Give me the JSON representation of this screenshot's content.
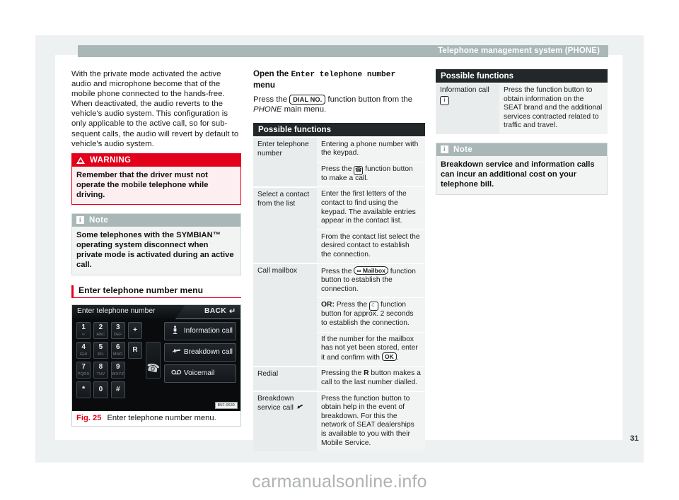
{
  "header": {
    "title": "Telephone management system (PHONE)"
  },
  "page_number": "31",
  "watermark": "carmanualsonline.info",
  "left_column": {
    "paragraph": "With the private mode activated the active audio and microphone become that of the mobile phone connected to the hands-free. When deactivated, the audio reverts to the vehicle's audio system. This configuration is only applicable to the active call, so for sub-sequent calls, the audio will revert by default to vehicle's audio system.",
    "warning": {
      "label": "WARNING",
      "icon": "warning-triangle-icon",
      "text": "Remember that the driver must not operate the mobile telephone while driving."
    },
    "note": {
      "label": "Note",
      "icon": "info-icon",
      "text": "Some telephones with the SYMBIAN™ operating system disconnect when private mode is activated during an active call."
    },
    "section_heading": "Enter telephone number menu",
    "figure": {
      "screen_title": "Enter telephone number",
      "back_label": "BACK",
      "keys": [
        {
          "num": "1",
          "letters": "∞"
        },
        {
          "num": "2",
          "letters": "ABC"
        },
        {
          "num": "3",
          "letters": "DEF"
        },
        {
          "num": "+",
          "letters": ""
        },
        {
          "num": "4",
          "letters": "GHI"
        },
        {
          "num": "5",
          "letters": "JKL"
        },
        {
          "num": "6",
          "letters": "MNO"
        },
        {
          "num": "R",
          "letters": ""
        },
        {
          "num": "7",
          "letters": "PQRS"
        },
        {
          "num": "8",
          "letters": "TUV"
        },
        {
          "num": "9",
          "letters": "WXYZ"
        },
        {
          "num": "*",
          "letters": ""
        },
        {
          "num": "0",
          "letters": ""
        },
        {
          "num": "#",
          "letters": ""
        }
      ],
      "call_button_icon": "phone-handset-icon",
      "side_buttons": [
        {
          "icon": "information-call-icon",
          "glyph": "ℹ",
          "label": "Information call"
        },
        {
          "icon": "breakdown-call-wrench-icon",
          "glyph": "—",
          "label": "Breakdown call"
        },
        {
          "icon": "voicemail-icon",
          "glyph": "∞",
          "label": "Voicemail"
        }
      ],
      "image_code": "B5F-0639",
      "caption_number": "Fig. 25",
      "caption_text": "Enter telephone number menu."
    }
  },
  "middle_column": {
    "heading_prefix": "Open the ",
    "heading_mono": "Enter telephone number",
    "heading_suffix": "menu",
    "instruction_pre": "Press the ",
    "instruction_button": "DIAL NO.",
    "instruction_post_1": " function button from the ",
    "instruction_italic": "PHONE",
    "instruction_post_2": " main menu.",
    "table": {
      "caption": "Possible functions",
      "rows": [
        {
          "function": "Enter telephone number",
          "details": [
            "Entering a phone number with the keypad.",
            "Press the 📞 function button to make a call."
          ]
        },
        {
          "function": "Select a contact from the list",
          "details": [
            "Enter the first letters of the contact to find using the keypad. The available entries appear in the contact list.",
            "From the contact list select the desired contact to establish the connection."
          ]
        },
        {
          "function": "Call mailbox",
          "details": [
            "Press the Mailbox function button to establish the connection.",
            "OR: Press the function button for approx. 2 seconds to establish the connection.",
            "If the number for the mailbox has not yet been stored, enter it and confirm with OK."
          ]
        },
        {
          "function": "Redial",
          "details": [
            "Pressing the R button makes a call to the last number dialled."
          ]
        },
        {
          "function": "Breakdown service call",
          "details": [
            "Press the function button to obtain help in the event of breakdown. For this the network of SEAT dealerships is available to you with their Mobile Service."
          ]
        }
      ]
    }
  },
  "right_column": {
    "table": {
      "caption": "Possible functions",
      "rows": [
        {
          "function": "Information call",
          "details": [
            "Press the function button to obtain information on the SEAT brand and the additional services contracted related to traffic and travel."
          ]
        }
      ]
    },
    "note": {
      "label": "Note",
      "icon": "info-icon",
      "text": "Breakdown service and information calls can incur an additional cost on your telephone bill."
    }
  }
}
